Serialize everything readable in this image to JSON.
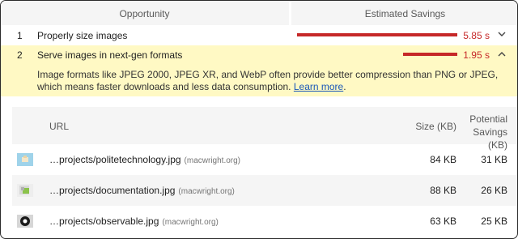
{
  "header": {
    "opportunity": "Opportunity",
    "estimated_savings": "Estimated Savings"
  },
  "opportunities": [
    {
      "index": "1",
      "title": "Properly size images",
      "savings": "5.85 s",
      "savings_fraction": 1.0,
      "expanded": false,
      "chevron_icon": "chevron-down-icon"
    },
    {
      "index": "2",
      "title": "Serve images in next-gen formats",
      "savings": "1.95 s",
      "savings_fraction": 0.34,
      "expanded": true,
      "chevron_icon": "chevron-up-icon",
      "description": "Image formats like JPEG 2000, JPEG XR, and WebP often provide better compression than PNG or JPEG, which means faster downloads and less data consumption. ",
      "learn_more": "Learn more",
      "description_end": "."
    }
  ],
  "table": {
    "headers": {
      "url": "URL",
      "size": "Size (KB)",
      "potential_line1": "Potential",
      "potential_line2": "Savings (KB)"
    },
    "rows": [
      {
        "url": "…projects/politetechnology.jpg",
        "domain": "(macwright.org)",
        "size": "84 KB",
        "savings": "31 KB",
        "icon": "thumbnail-politetechnology-icon"
      },
      {
        "url": "…projects/documentation.jpg",
        "domain": "(macwright.org)",
        "size": "88 KB",
        "savings": "26 KB",
        "icon": "thumbnail-documentation-icon"
      },
      {
        "url": "…projects/observable.jpg",
        "domain": "(macwright.org)",
        "size": "63 KB",
        "savings": "25 KB",
        "icon": "thumbnail-observable-icon"
      }
    ]
  },
  "colors": {
    "savings_red": "#c62828",
    "highlight_yellow": "#fff9c4",
    "link_blue": "#1a57b8"
  }
}
